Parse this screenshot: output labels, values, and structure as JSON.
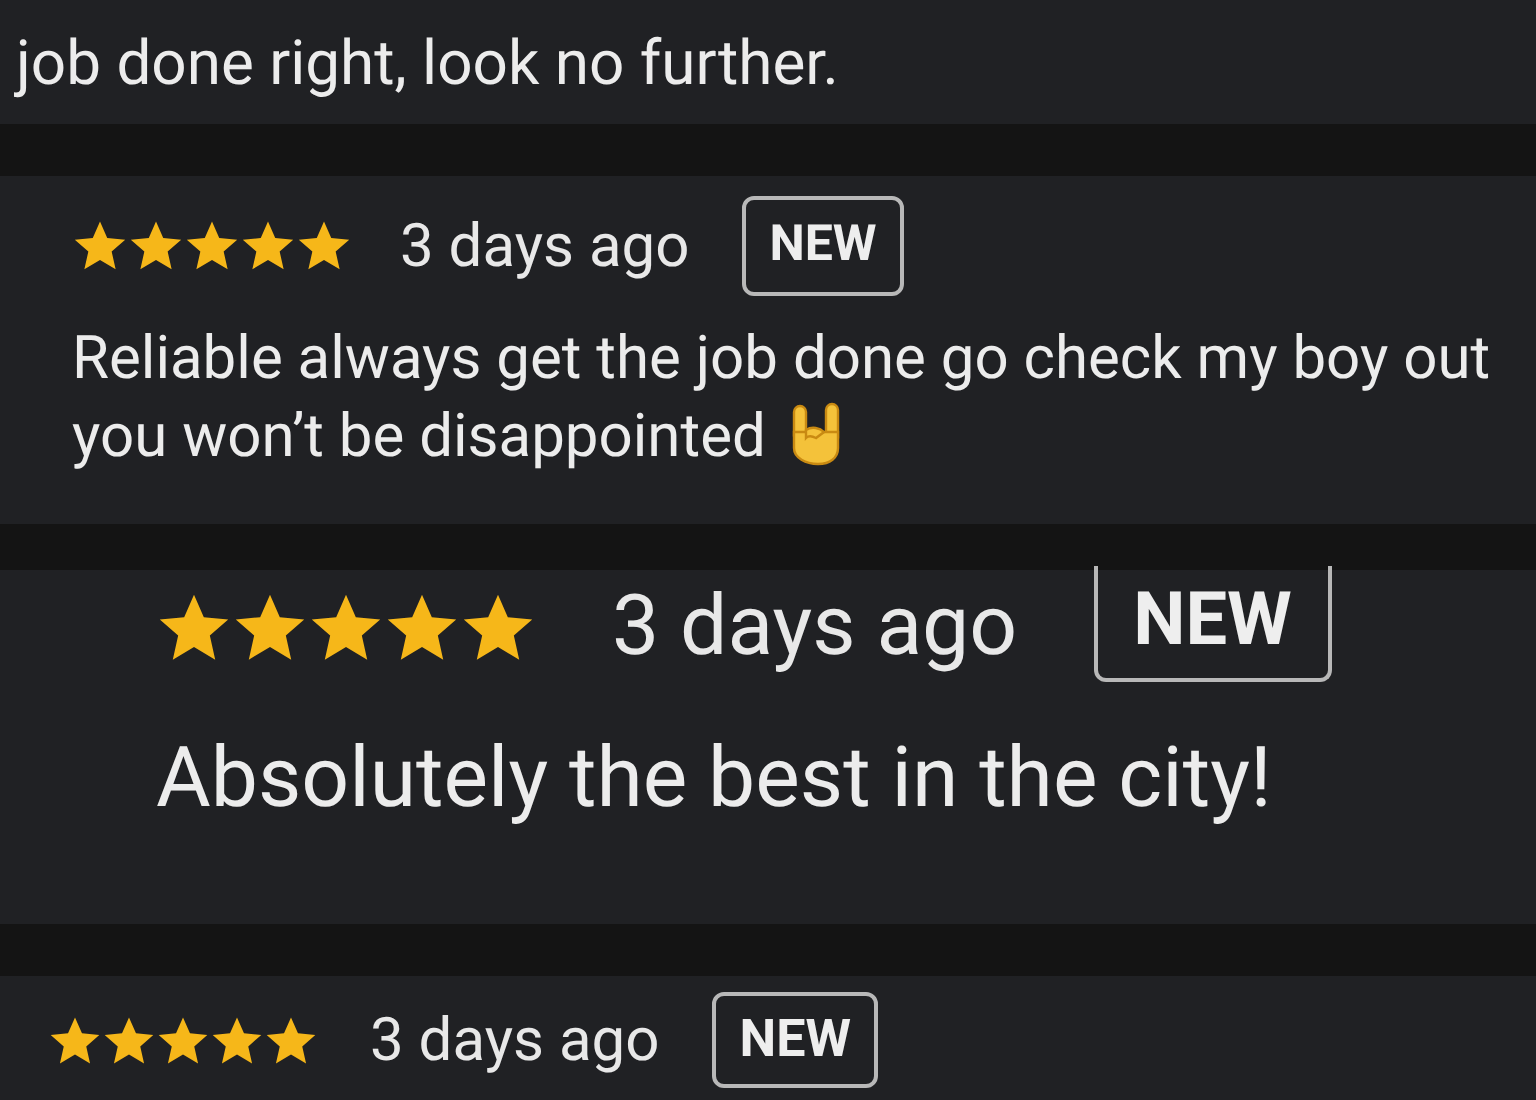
{
  "reviews": [
    {
      "text": "job done right, look no further."
    },
    {
      "stars": 5,
      "time": "3 days ago",
      "badge": "NEW",
      "text": "Reliable always get the job done go check my boy out you won’t be disappointed",
      "trailing_emoji": true
    },
    {
      "stars": 5,
      "time": "3 days ago",
      "badge": "NEW",
      "text": "Absolutely the best in the city!"
    },
    {
      "stars": 5,
      "time": "3 days ago",
      "badge": "NEW"
    }
  ]
}
